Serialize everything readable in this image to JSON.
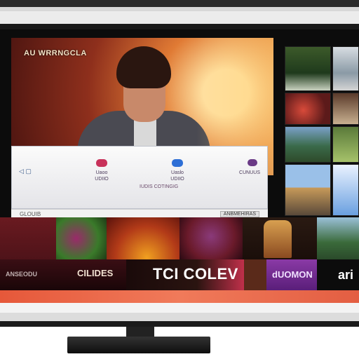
{
  "screen": {
    "channel_title": "AU WRRNGCLA",
    "info_panel": {
      "left_icon": "◁ ▢",
      "columns": [
        {
          "label": "Uaoo\nUDIIO",
          "color": "#c8325a"
        },
        {
          "label": "Uaslo\nUDIIO",
          "color": "#2e6fd6"
        }
      ],
      "end_label": "CUNUUS",
      "center_note": "IUDIS COTINGIG"
    },
    "status": {
      "left": "GLOUIB",
      "right": "ANBMEHIRAS"
    }
  },
  "bottom_strip": {
    "left_caption": "ANSEODU",
    "mid_caption": "CILIDES",
    "main_brand": "TCI COLEV",
    "purple_tile_text": "dUOMON",
    "right_text": "ari"
  }
}
